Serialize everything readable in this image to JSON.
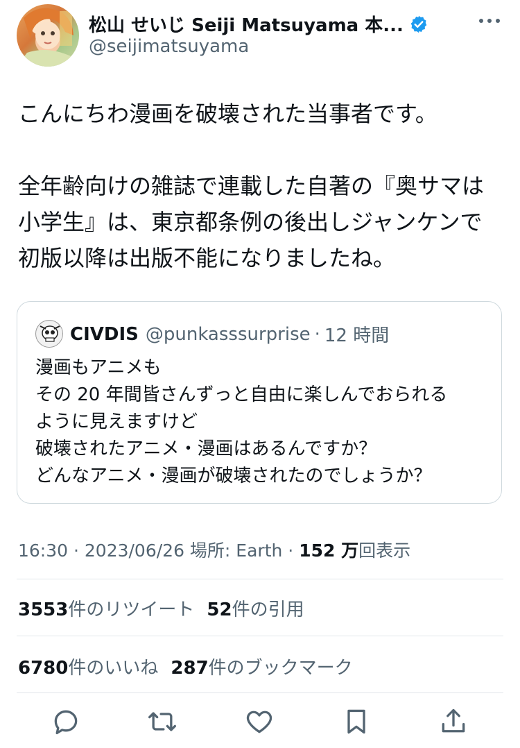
{
  "author": {
    "display_name": "松山 せいじ Seiji Matsuyama 本...",
    "handle": "@seijimatsuyama",
    "verified_icon": "verified-badge-icon",
    "avatar": "manga-character-avatar"
  },
  "tweet": {
    "text": "こんにちわ漫画を破壊された当事者です。\n\n全年齢向けの雑誌で連載した自著の『奥サマは小学生』は、東京都条例の後出しジャンケンで初版以降は出版不能になりましたね。"
  },
  "quote": {
    "name": "CIVDIS",
    "handle": "@punkasssurprise",
    "separator": "·",
    "time": "12 時間",
    "text": "漫画もアニメも\nその 20 年間皆さんずっと自由に楽しんでおられる\nように見えますけど\n破壊されたアニメ・漫画はあるんですか？\nどんなアニメ・漫画が破壊されたのでしょうか？"
  },
  "meta": {
    "time": "16:30",
    "sep1": " · ",
    "date": "2023/06/26",
    "location": " 場所: Earth",
    "sep2": " · ",
    "views_count": "152 万",
    "views_label": "回表示"
  },
  "stats": {
    "retweets_count": "3553",
    "retweets_label": "件のリツイート",
    "quotes_count": "52",
    "quotes_label": "件の引用",
    "likes_count": "6780",
    "likes_label": "件のいいね",
    "bookmarks_count": "287",
    "bookmarks_label": "件のブックマーク"
  },
  "actions": [
    "reply-icon",
    "retweet-icon",
    "like-icon",
    "bookmark-icon",
    "share-icon"
  ],
  "colors": {
    "text": "#0f1419",
    "secondary": "#536471",
    "verified": "#1d9bf0",
    "border": "#cfd9de"
  }
}
